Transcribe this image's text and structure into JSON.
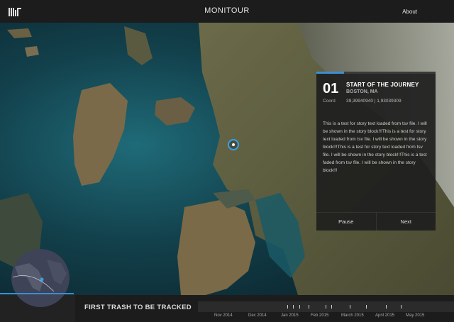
{
  "header": {
    "title": "MONITOUR",
    "about": "About"
  },
  "story": {
    "number": "01",
    "title": "START OF THE JOURNEY",
    "subtitle": "BOSTON, MA",
    "coord_label": "Coord",
    "coord_value": "39,39940940 | 1,93039309",
    "text": "This is a test for story text loaded from tsv file. I will be shown in the story block!!!This is a test for story text loaded from tsv file. I will be shown in the story block!!!This is a test for story text loaded from tsv file. I will be shown in the story block!!!This is a test faded from tsv file. I will be shown in the story block!!!",
    "pause_label": "Pause",
    "next_label": "Next",
    "progress": 0.23
  },
  "footer": {
    "title": "FIRST TRASH TO BE TRACKED",
    "months": [
      "Nov 2014",
      "Dec 2014",
      "Jan 2015",
      "Feb 2015",
      "March 2015",
      "April 2015",
      "May 2015"
    ]
  },
  "colors": {
    "accent": "#3b8fd0",
    "marker": "#3aa0e6",
    "panel": "#1e1e1e"
  },
  "icons": {
    "logo": "mit-logo",
    "marker": "location-marker-icon"
  }
}
